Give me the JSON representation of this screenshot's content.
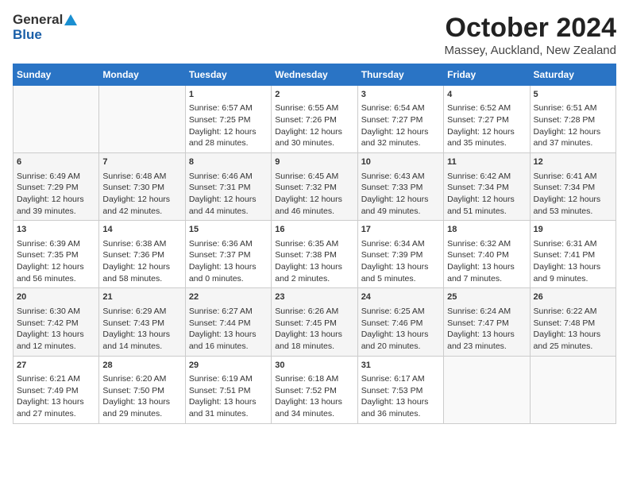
{
  "header": {
    "logo_general": "General",
    "logo_blue": "Blue",
    "title": "October 2024",
    "subtitle": "Massey, Auckland, New Zealand"
  },
  "days_of_week": [
    "Sunday",
    "Monday",
    "Tuesday",
    "Wednesday",
    "Thursday",
    "Friday",
    "Saturday"
  ],
  "weeks": [
    [
      {
        "day": "",
        "content": ""
      },
      {
        "day": "",
        "content": ""
      },
      {
        "day": "1",
        "content": "Sunrise: 6:57 AM\nSunset: 7:25 PM\nDaylight: 12 hours\nand 28 minutes."
      },
      {
        "day": "2",
        "content": "Sunrise: 6:55 AM\nSunset: 7:26 PM\nDaylight: 12 hours\nand 30 minutes."
      },
      {
        "day": "3",
        "content": "Sunrise: 6:54 AM\nSunset: 7:27 PM\nDaylight: 12 hours\nand 32 minutes."
      },
      {
        "day": "4",
        "content": "Sunrise: 6:52 AM\nSunset: 7:27 PM\nDaylight: 12 hours\nand 35 minutes."
      },
      {
        "day": "5",
        "content": "Sunrise: 6:51 AM\nSunset: 7:28 PM\nDaylight: 12 hours\nand 37 minutes."
      }
    ],
    [
      {
        "day": "6",
        "content": "Sunrise: 6:49 AM\nSunset: 7:29 PM\nDaylight: 12 hours\nand 39 minutes."
      },
      {
        "day": "7",
        "content": "Sunrise: 6:48 AM\nSunset: 7:30 PM\nDaylight: 12 hours\nand 42 minutes."
      },
      {
        "day": "8",
        "content": "Sunrise: 6:46 AM\nSunset: 7:31 PM\nDaylight: 12 hours\nand 44 minutes."
      },
      {
        "day": "9",
        "content": "Sunrise: 6:45 AM\nSunset: 7:32 PM\nDaylight: 12 hours\nand 46 minutes."
      },
      {
        "day": "10",
        "content": "Sunrise: 6:43 AM\nSunset: 7:33 PM\nDaylight: 12 hours\nand 49 minutes."
      },
      {
        "day": "11",
        "content": "Sunrise: 6:42 AM\nSunset: 7:34 PM\nDaylight: 12 hours\nand 51 minutes."
      },
      {
        "day": "12",
        "content": "Sunrise: 6:41 AM\nSunset: 7:34 PM\nDaylight: 12 hours\nand 53 minutes."
      }
    ],
    [
      {
        "day": "13",
        "content": "Sunrise: 6:39 AM\nSunset: 7:35 PM\nDaylight: 12 hours\nand 56 minutes."
      },
      {
        "day": "14",
        "content": "Sunrise: 6:38 AM\nSunset: 7:36 PM\nDaylight: 12 hours\nand 58 minutes."
      },
      {
        "day": "15",
        "content": "Sunrise: 6:36 AM\nSunset: 7:37 PM\nDaylight: 13 hours\nand 0 minutes."
      },
      {
        "day": "16",
        "content": "Sunrise: 6:35 AM\nSunset: 7:38 PM\nDaylight: 13 hours\nand 2 minutes."
      },
      {
        "day": "17",
        "content": "Sunrise: 6:34 AM\nSunset: 7:39 PM\nDaylight: 13 hours\nand 5 minutes."
      },
      {
        "day": "18",
        "content": "Sunrise: 6:32 AM\nSunset: 7:40 PM\nDaylight: 13 hours\nand 7 minutes."
      },
      {
        "day": "19",
        "content": "Sunrise: 6:31 AM\nSunset: 7:41 PM\nDaylight: 13 hours\nand 9 minutes."
      }
    ],
    [
      {
        "day": "20",
        "content": "Sunrise: 6:30 AM\nSunset: 7:42 PM\nDaylight: 13 hours\nand 12 minutes."
      },
      {
        "day": "21",
        "content": "Sunrise: 6:29 AM\nSunset: 7:43 PM\nDaylight: 13 hours\nand 14 minutes."
      },
      {
        "day": "22",
        "content": "Sunrise: 6:27 AM\nSunset: 7:44 PM\nDaylight: 13 hours\nand 16 minutes."
      },
      {
        "day": "23",
        "content": "Sunrise: 6:26 AM\nSunset: 7:45 PM\nDaylight: 13 hours\nand 18 minutes."
      },
      {
        "day": "24",
        "content": "Sunrise: 6:25 AM\nSunset: 7:46 PM\nDaylight: 13 hours\nand 20 minutes."
      },
      {
        "day": "25",
        "content": "Sunrise: 6:24 AM\nSunset: 7:47 PM\nDaylight: 13 hours\nand 23 minutes."
      },
      {
        "day": "26",
        "content": "Sunrise: 6:22 AM\nSunset: 7:48 PM\nDaylight: 13 hours\nand 25 minutes."
      }
    ],
    [
      {
        "day": "27",
        "content": "Sunrise: 6:21 AM\nSunset: 7:49 PM\nDaylight: 13 hours\nand 27 minutes."
      },
      {
        "day": "28",
        "content": "Sunrise: 6:20 AM\nSunset: 7:50 PM\nDaylight: 13 hours\nand 29 minutes."
      },
      {
        "day": "29",
        "content": "Sunrise: 6:19 AM\nSunset: 7:51 PM\nDaylight: 13 hours\nand 31 minutes."
      },
      {
        "day": "30",
        "content": "Sunrise: 6:18 AM\nSunset: 7:52 PM\nDaylight: 13 hours\nand 34 minutes."
      },
      {
        "day": "31",
        "content": "Sunrise: 6:17 AM\nSunset: 7:53 PM\nDaylight: 13 hours\nand 36 minutes."
      },
      {
        "day": "",
        "content": ""
      },
      {
        "day": "",
        "content": ""
      }
    ]
  ]
}
